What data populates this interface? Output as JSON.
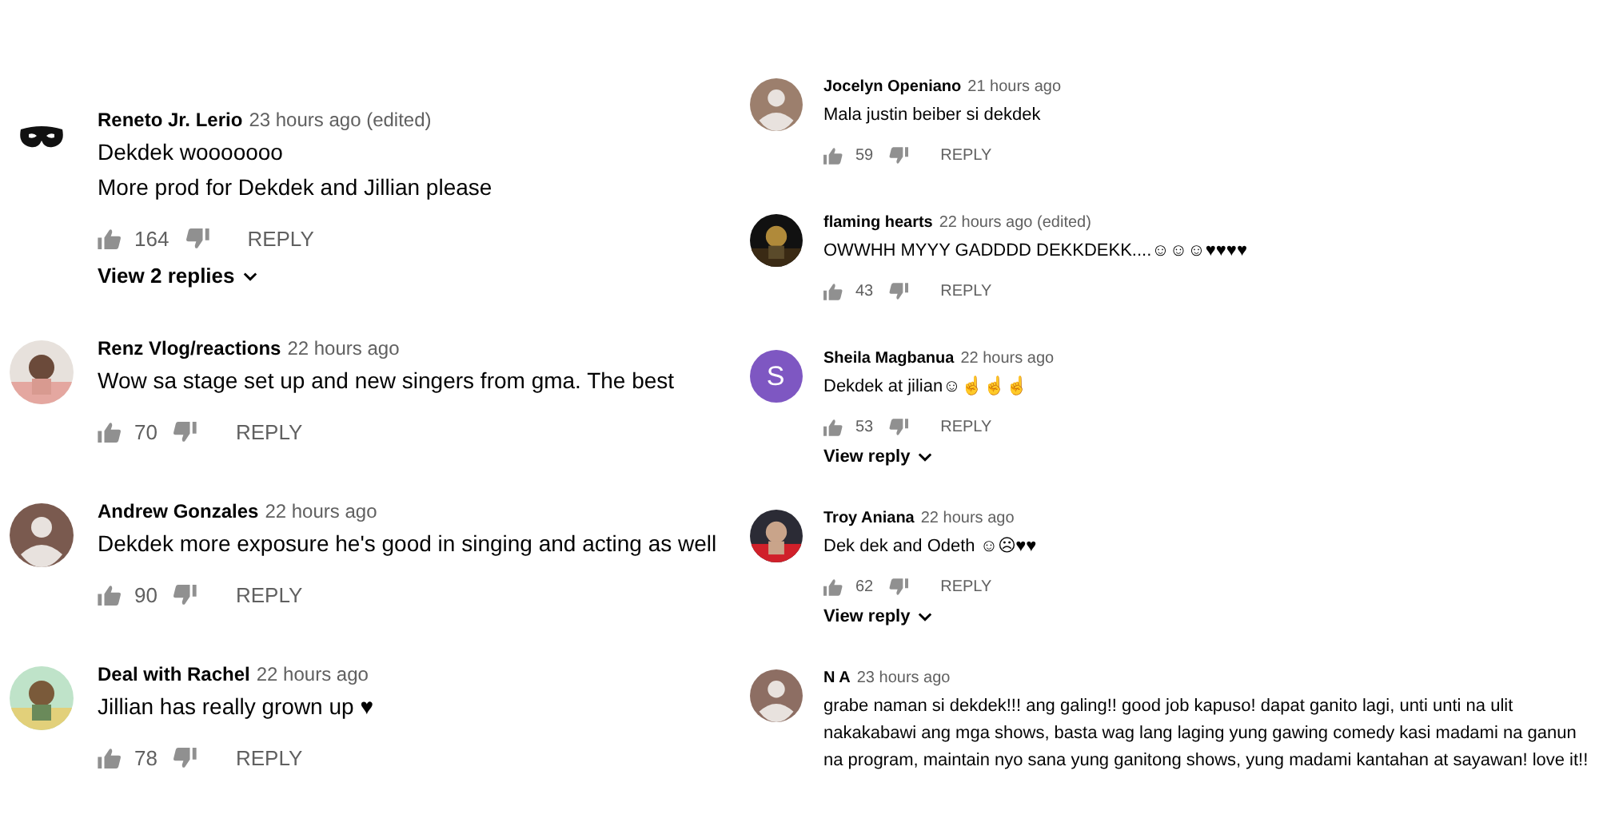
{
  "columns": [
    {
      "comments": [
        {
          "avatar": {
            "kind": "mask"
          },
          "author": "Reneto Jr. Lerio",
          "time": "23 hours ago (edited)",
          "lines": [
            "Dekdek wooooooo",
            "More prod for Dekdek and Jillian please"
          ],
          "likes": "164",
          "reply": "REPLY",
          "view_replies": "View 2 replies"
        },
        {
          "avatar": {
            "kind": "picture"
          },
          "author": "Renz Vlog/reactions",
          "time": "22 hours ago",
          "lines": [
            "Wow sa stage set up and   new singers from gma. The best"
          ],
          "likes": "70",
          "reply": "REPLY"
        },
        {
          "avatar": {
            "kind": "default",
            "color": "#7a5a4f"
          },
          "author": "Andrew Gonzales",
          "time": "22 hours ago",
          "lines": [
            "Dekdek more exposure he's good in singing and acting as well"
          ],
          "likes": "90",
          "reply": "REPLY"
        },
        {
          "avatar": {
            "kind": "picture"
          },
          "author": "Deal with Rachel",
          "time": "22 hours ago",
          "lines": [
            "Jillian has really grown up ♥"
          ],
          "likes": "78",
          "reply": "REPLY"
        }
      ]
    },
    {
      "comments": [
        {
          "avatar": {
            "kind": "default",
            "color": "#9c7f6d"
          },
          "author": "Jocelyn Openiano",
          "time": "21 hours ago",
          "lines": [
            "Mala justin beiber si dekdek"
          ],
          "likes": "59",
          "reply": "REPLY"
        },
        {
          "avatar": {
            "kind": "picture"
          },
          "author": "flaming hearts",
          "time": "22 hours ago (edited)",
          "lines": [
            "OWWHH MYYY GADDDD DEKKDEKK....☺☺☺♥♥♥♥"
          ],
          "likes": "43",
          "reply": "REPLY"
        },
        {
          "avatar": {
            "kind": "letter",
            "letter": "S",
            "color": "#7e57c2"
          },
          "author": "Sheila Magbanua",
          "time": "22 hours ago",
          "lines": [
            "Dekdek at jilian☺☝☝☝"
          ],
          "likes": "53",
          "reply": "REPLY",
          "view_replies": "View reply"
        },
        {
          "avatar": {
            "kind": "picture"
          },
          "author": "Troy Aniana",
          "time": "22 hours ago",
          "lines": [
            "Dek dek and Odeth ☺☹♥♥"
          ],
          "likes": "62",
          "reply": "REPLY",
          "view_replies": "View reply"
        },
        {
          "avatar": {
            "kind": "default",
            "color": "#8d6e63"
          },
          "author": "N A",
          "time": "23 hours ago",
          "lines": [
            "grabe naman si dekdek!!! ang galing!! good job kapuso! dapat ganito lagi, unti unti na ulit nakakabawi ang mga shows, basta wag lang laging yung gawing comedy kasi madami na ganun na program, maintain nyo sana yung ganitong shows, yung madami kantahan at sayawan! love it!!"
          ]
        }
      ]
    }
  ]
}
